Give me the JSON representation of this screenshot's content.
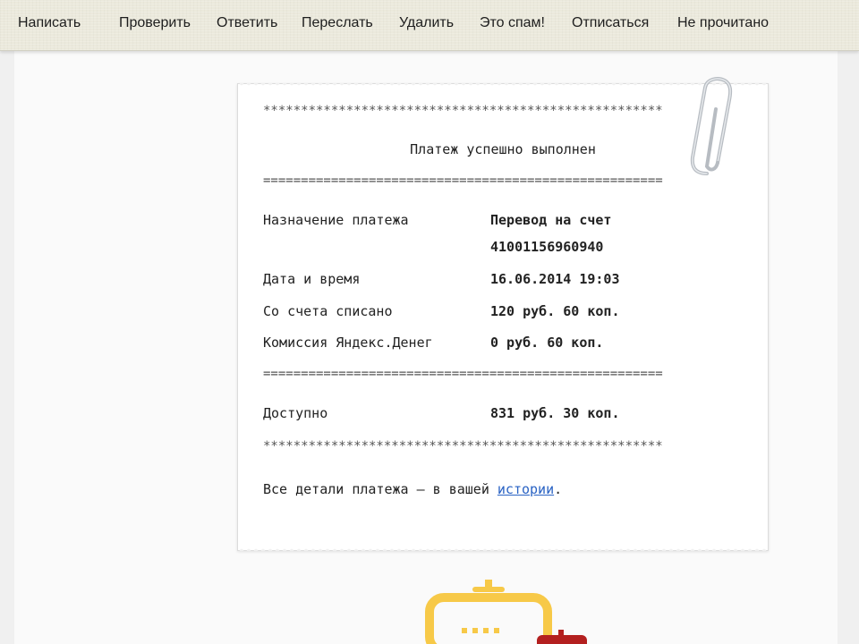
{
  "toolbar": {
    "items": [
      {
        "label": "Написать"
      },
      {
        "label": "Проверить"
      },
      {
        "label": "Ответить"
      },
      {
        "label": "Переслать"
      },
      {
        "label": "Удалить"
      },
      {
        "label": "Это спам!"
      },
      {
        "label": "Отписаться"
      },
      {
        "label": "Не прочитано"
      }
    ]
  },
  "receipt": {
    "stars_top": "*****************************************************",
    "title": "Платеж успешно выполнен",
    "equals_1": "=====================================================",
    "rows": [
      {
        "label": "Назначение платежа",
        "value_line1": "Перевод на счет",
        "value_line2": "41001156960940"
      },
      {
        "label": "Дата и время",
        "value": "16.06.2014 19:03"
      },
      {
        "label": "Со счета списано",
        "value": "120 руб. 60 коп."
      },
      {
        "label": "Комиссия Яндекс.Денег",
        "value": "0 руб. 60 коп."
      }
    ],
    "equals_2": "=====================================================",
    "available_label": "Доступно",
    "available_value": "831 руб. 30 коп.",
    "stars_bottom": "*****************************************************",
    "footer_prefix": "Все детали платежа — в вашей ",
    "footer_link": "истории",
    "footer_suffix": "."
  },
  "colors": {
    "link": "#2a63c4",
    "illustration_yellow": "#f7c948",
    "illustration_red": "#b3201f"
  }
}
